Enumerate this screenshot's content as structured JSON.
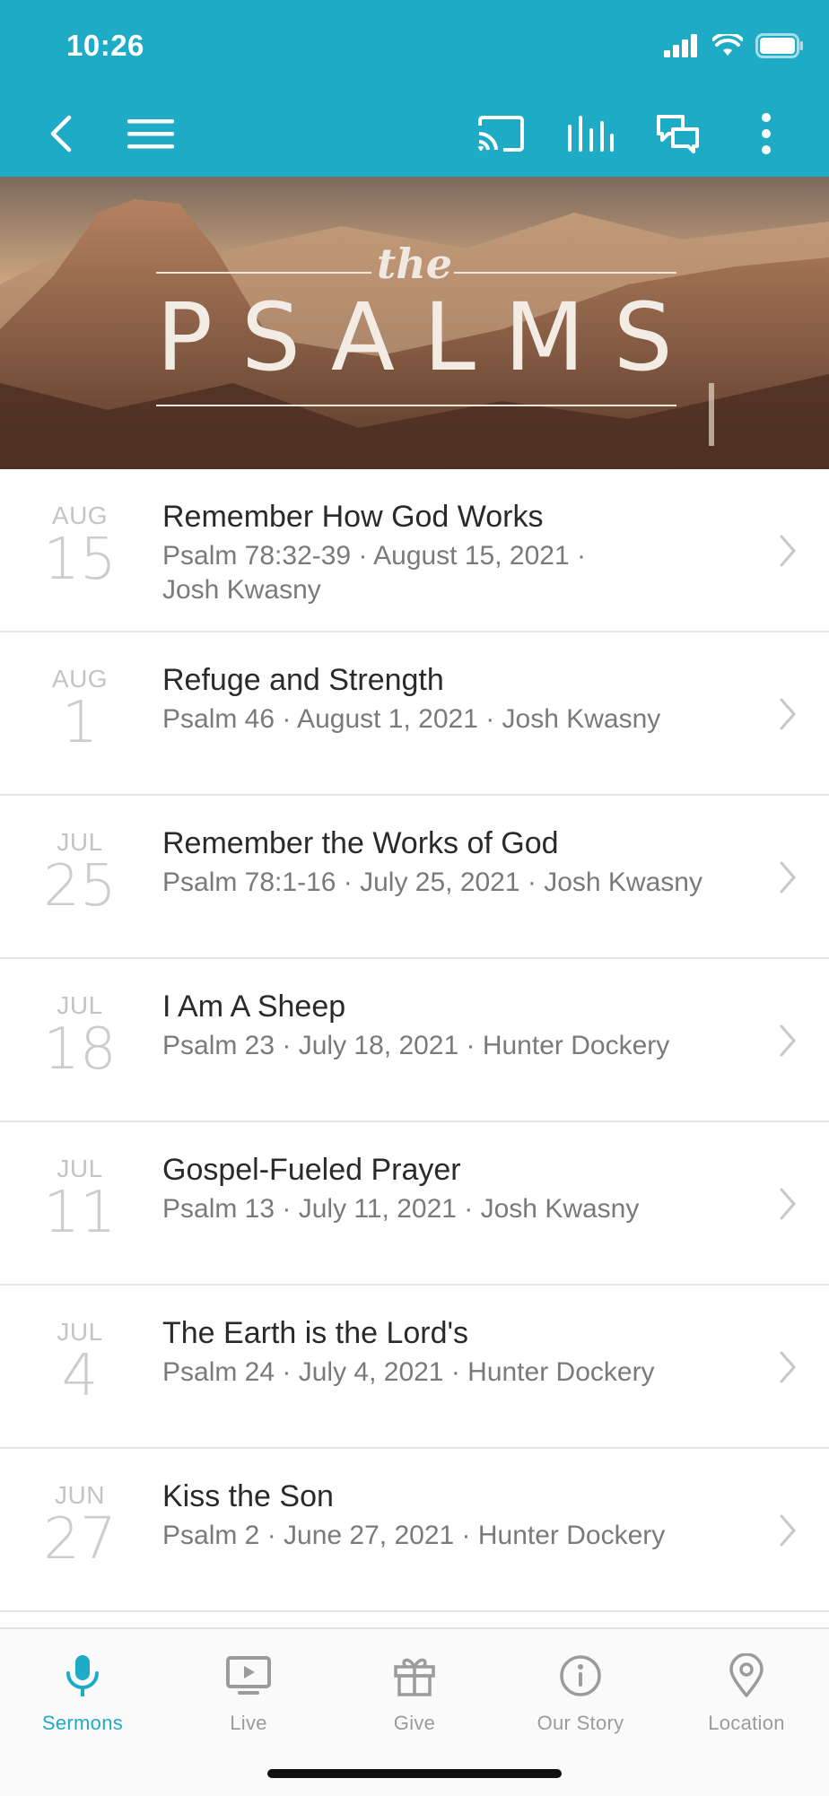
{
  "status": {
    "time": "10:26"
  },
  "hero": {
    "small_title": "the",
    "title": "PSALMS"
  },
  "sermons": [
    {
      "month": "AUG",
      "day": "15",
      "title": "Remember How God Works",
      "subtitle": "Psalm 78:32-39 · August 15, 2021 · Josh Kwasny"
    },
    {
      "month": "AUG",
      "day": "1",
      "title": "Refuge and Strength",
      "subtitle": "Psalm 46 · August 1, 2021 · Josh Kwasny"
    },
    {
      "month": "JUL",
      "day": "25",
      "title": "Remember the Works of God",
      "subtitle": "Psalm 78:1-16 · July 25, 2021 · Josh Kwasny"
    },
    {
      "month": "JUL",
      "day": "18",
      "title": "I Am A Sheep",
      "subtitle": "Psalm 23 · July 18, 2021 · Hunter Dockery"
    },
    {
      "month": "JUL",
      "day": "11",
      "title": "Gospel-Fueled Prayer",
      "subtitle": "Psalm 13 · July 11, 2021 · Josh Kwasny"
    },
    {
      "month": "JUL",
      "day": "4",
      "title": "The Earth is the Lord's",
      "subtitle": "Psalm 24 · July 4, 2021 · Hunter Dockery"
    },
    {
      "month": "JUN",
      "day": "27",
      "title": "Kiss the Son",
      "subtitle": "Psalm 2 · June 27, 2021 · Hunter Dockery"
    }
  ],
  "tabs": [
    {
      "label": "Sermons",
      "icon": "microphone-icon",
      "active": true
    },
    {
      "label": "Live",
      "icon": "tv-icon",
      "active": false
    },
    {
      "label": "Give",
      "icon": "gift-icon",
      "active": false
    },
    {
      "label": "Our Story",
      "icon": "info-icon",
      "active": false
    },
    {
      "label": "Location",
      "icon": "location-pin-icon",
      "active": false
    }
  ],
  "colors": {
    "accent": "#1eabc6",
    "tab_inactive": "#9b9b9b",
    "divider": "#e6e6e6"
  }
}
